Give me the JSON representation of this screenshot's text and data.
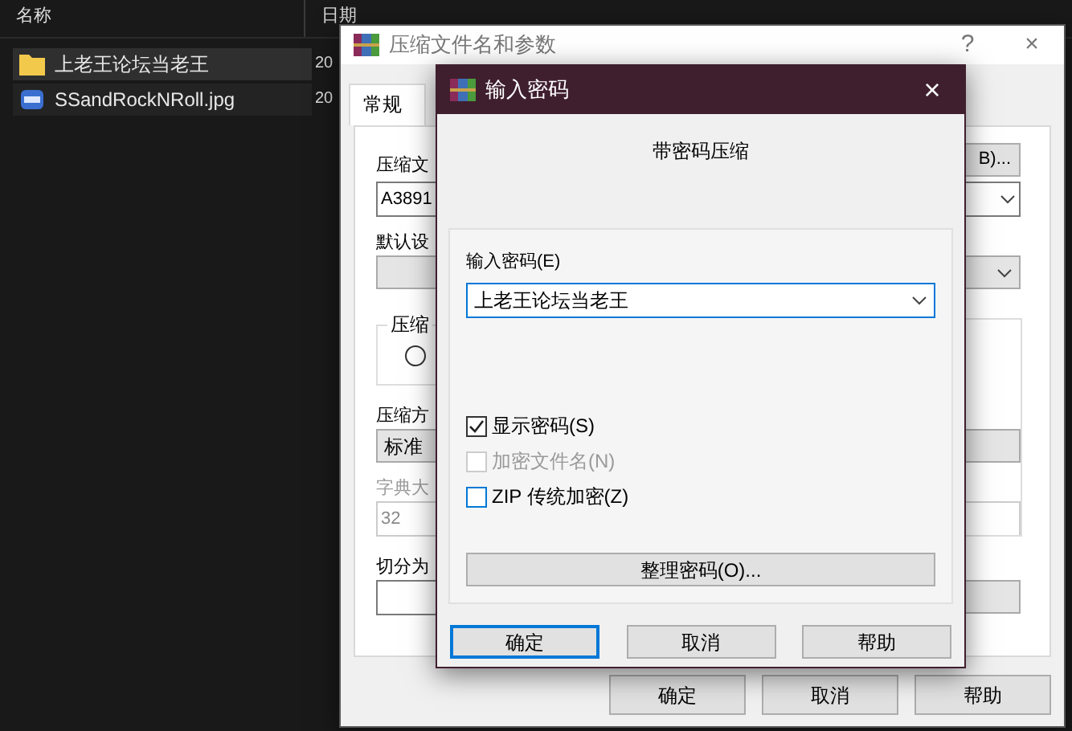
{
  "explorer": {
    "columns": [
      "名称",
      "日期"
    ],
    "rows": [
      {
        "kind": "folder",
        "name": "上老王论坛当老王",
        "date": "20",
        "selected": true
      },
      {
        "kind": "image",
        "name": "SSandRockNRoll.jpg",
        "date": "20",
        "selected": false
      }
    ]
  },
  "archive_window": {
    "title": "压缩文件名和参数",
    "help_button": "?",
    "close_button": "×",
    "tabs": [
      {
        "label": "常规",
        "selected": true
      }
    ],
    "archive_name": {
      "label": "压缩文",
      "value": "A3891",
      "browse_button": "B)..."
    },
    "profile": {
      "label": "默认设"
    },
    "format_group": {
      "legend": "压缩",
      "radio": {
        "selected": false
      }
    },
    "method": {
      "label": "压缩方",
      "value": "标准"
    },
    "dictionary": {
      "label": "字典大",
      "value": "32",
      "disabled": true
    },
    "split": {
      "label": "切分为"
    },
    "buttons": [
      {
        "label": "确定",
        "default": false
      },
      {
        "label": "取消",
        "default": false
      },
      {
        "label": "帮助",
        "default": false
      }
    ]
  },
  "password_dialog": {
    "title": "输入密码",
    "close_button": "×",
    "heading": "带密码压缩",
    "password": {
      "label": "输入密码(E)",
      "value": "上老王论坛当老王"
    },
    "options": [
      {
        "label": "显示密码(S)",
        "checked": true,
        "disabled": false
      },
      {
        "label": "加密文件名(N)",
        "checked": false,
        "disabled": true
      },
      {
        "label": "ZIP 传统加密(Z)",
        "checked": false,
        "disabled": false
      }
    ],
    "organize_button": "整理密码(O)...",
    "buttons": [
      {
        "label": "确定",
        "default": true
      },
      {
        "label": "取消",
        "default": false
      },
      {
        "label": "帮助",
        "default": false
      }
    ]
  }
}
